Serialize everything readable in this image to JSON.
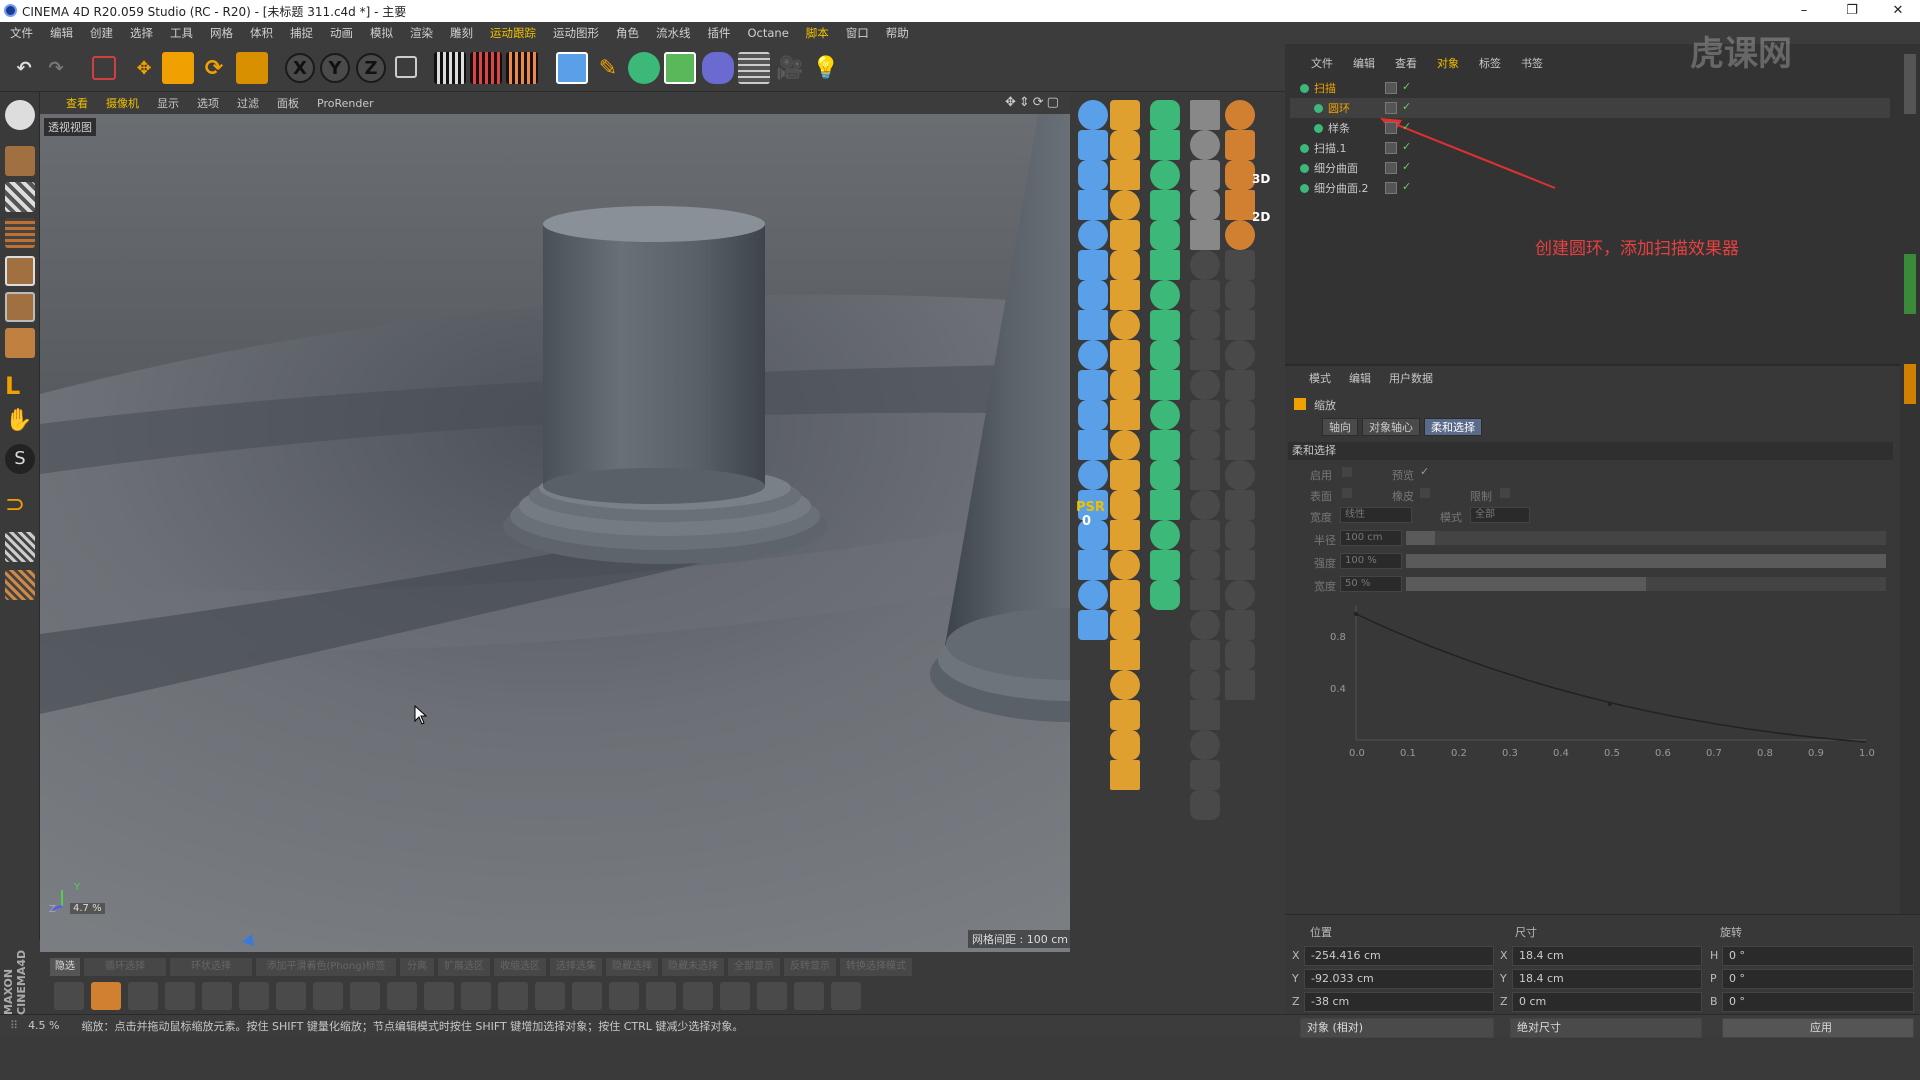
{
  "window": {
    "title": "CINEMA 4D R20.059 Studio (RC - R20) - [未标题 311.c4d *] - 主要",
    "min": "–",
    "max": "❐",
    "close": "✕"
  },
  "menu": [
    "文件",
    "编辑",
    "创建",
    "选择",
    "工具",
    "网格",
    "体积",
    "捕捉",
    "动画",
    "模拟",
    "渲染",
    "雕刻",
    "运动跟踪",
    "运动图形",
    "角色",
    "流水线",
    "插件",
    "Octane",
    "脚本",
    "窗口",
    "帮助"
  ],
  "menu_highlight": [
    "运动跟踪",
    "脚本"
  ],
  "toolbar": {
    "axis_x": "X",
    "axis_y": "Y",
    "axis_z": "Z"
  },
  "viewport": {
    "tabs": [
      "查看",
      "摄像机",
      "显示",
      "选项",
      "过滤",
      "面板",
      "ProRender"
    ],
    "label": "透视视图",
    "grid_spacing": "网格间距 : 100 cm",
    "zoom": "4.7 %",
    "axis_y": "Y",
    "axis_z": "Z"
  },
  "objtools_text": {
    "psr": "PSR",
    "zero": "0",
    "three_d": "3D",
    "two_d": "2D"
  },
  "object_manager": {
    "tabs": [
      "文件",
      "编辑",
      "查看",
      "对象",
      "标签",
      "书签"
    ],
    "active_tab": "对象",
    "items": [
      {
        "name": "扫描",
        "highlight": true
      },
      {
        "name": "圆环",
        "highlight": true
      },
      {
        "name": "样条",
        "highlight": false
      },
      {
        "name": "扫描.1",
        "highlight": false
      },
      {
        "name": "细分曲面",
        "highlight": false
      },
      {
        "name": "细分曲面.2",
        "highlight": false
      }
    ],
    "annotation": "创建圆环，添加扫描效果器"
  },
  "attribute_manager": {
    "tabs": [
      "模式",
      "编辑",
      "用户数据"
    ],
    "object_name": "缩放",
    "subtabs": [
      "轴向",
      "对象轴心",
      "柔和选择"
    ],
    "active_subtab": "柔和选择",
    "section": "柔和选择",
    "row1": {
      "enable": "启用",
      "preview": "预览"
    },
    "row2": {
      "surface": "表面",
      "rubber": "橡皮",
      "limit": "限制"
    },
    "row3": {
      "width_label": "宽度",
      "width_value": "线性",
      "mode_label": "模式",
      "mode_value": "全部"
    },
    "radius": {
      "label": "半径",
      "value": "100 cm",
      "fill": 0.06
    },
    "strength": {
      "label": "强度",
      "value": "100 %",
      "fill": 1.0
    },
    "falloff": {
      "label": "宽度",
      "value": "50 %",
      "fill": 0.5
    },
    "graph": {
      "x_ticks": [
        "0.0",
        "0.1",
        "0.2",
        "0.3",
        "0.4",
        "0.5",
        "0.6",
        "0.7",
        "0.8",
        "0.9",
        "1.0"
      ],
      "y_ticks": [
        "0.8",
        "0.4"
      ]
    }
  },
  "coordinates": {
    "headers": [
      "位置",
      "尺寸",
      "旋转"
    ],
    "rows": [
      {
        "a": "X",
        "pos": "-254.416 cm",
        "b": "X",
        "size": "18.4 cm",
        "c": "H",
        "rot": "0 °"
      },
      {
        "a": "Y",
        "pos": "-92.033 cm",
        "b": "Y",
        "size": "18.4 cm",
        "c": "P",
        "rot": "0 °"
      },
      {
        "a": "Z",
        "pos": "-38 cm",
        "b": "Z",
        "size": "0 cm",
        "c": "B",
        "rot": "0 °"
      }
    ],
    "mode": "对象 (相对)",
    "size_mode": "绝对尺寸",
    "apply": "应用"
  },
  "bottom_tabs": [
    "隐选",
    "循环选择",
    "环状选择",
    "添加平滑着色(Phong)标签",
    "分离",
    "扩展选区",
    "收缩选区",
    "选择选集",
    "隐藏选择",
    "隐藏未选择",
    "全部显示",
    "反转显示",
    "转换选择模式"
  ],
  "status": {
    "zoom": "4.5 %",
    "text": "缩放：点击并拖动鼠标缩放元素。按住 SHIFT 键量化缩放；节点编辑模式时按住 SHIFT 键增加选择对象；按住 CTRL 键减少选择对象。"
  },
  "brand": "MAXON CINEMA4D",
  "watermark": "虎课网"
}
